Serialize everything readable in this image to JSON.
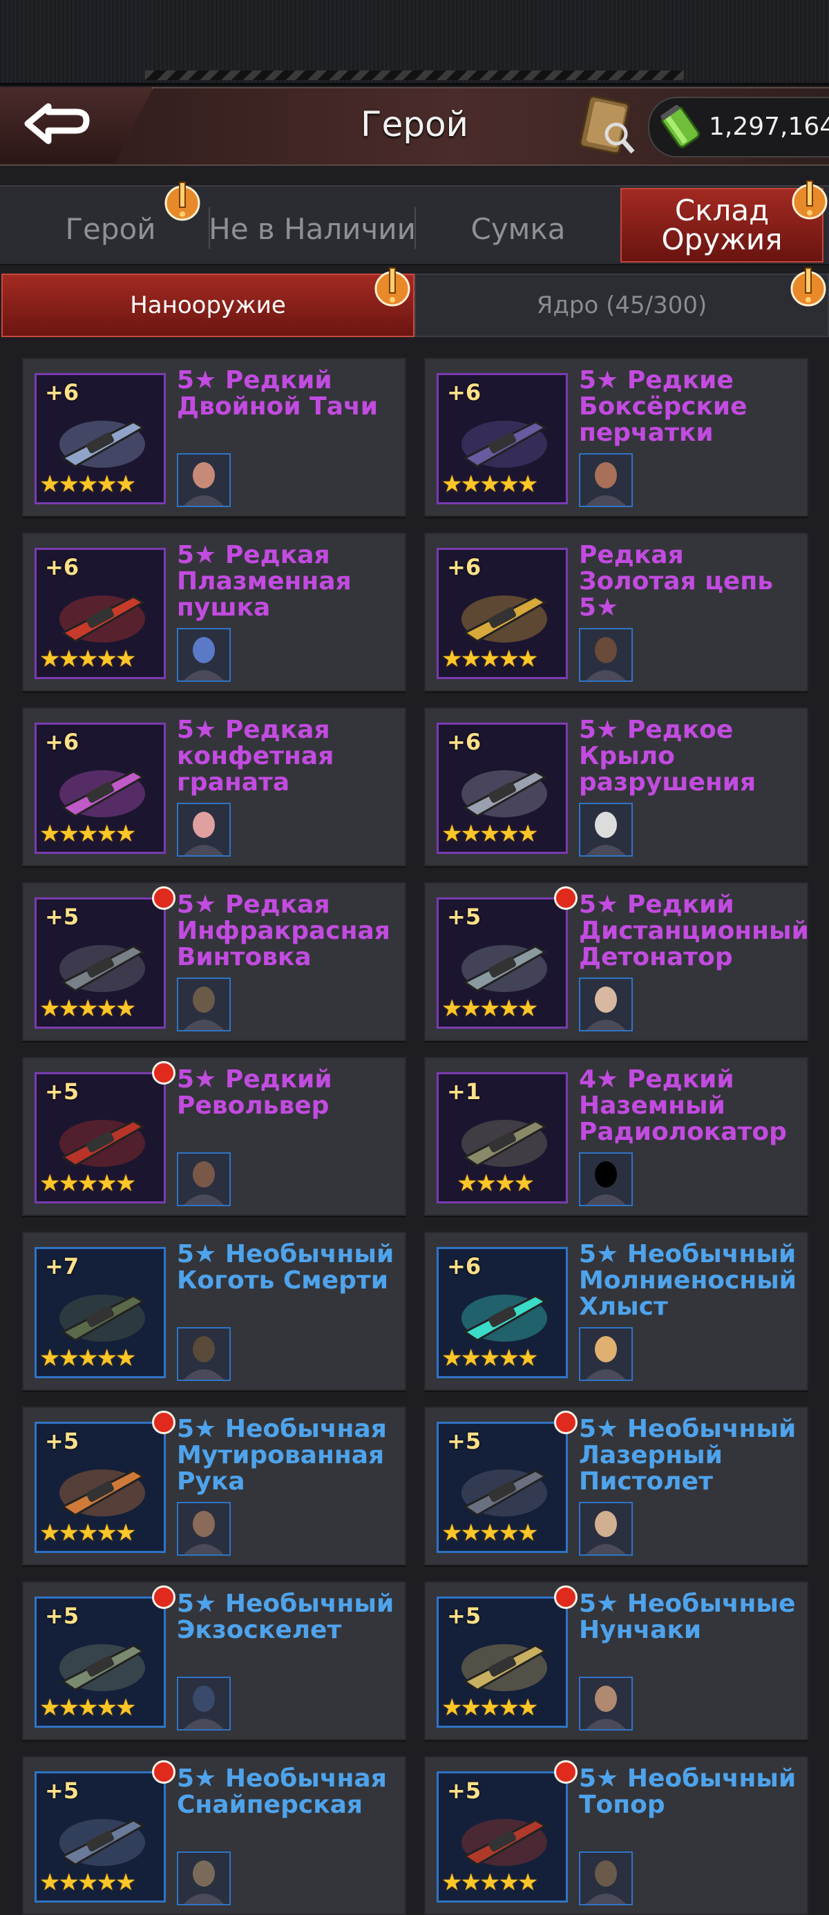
{
  "header": {
    "title": "Герой",
    "currency_amount": "1,297,164"
  },
  "tabs": [
    {
      "label": "Герой",
      "active": false,
      "alert": true
    },
    {
      "label": "Не в Наличии",
      "active": false,
      "alert": false
    },
    {
      "label": "Сумка",
      "active": false,
      "alert": false
    },
    {
      "label": "Склад Оружия",
      "active": true,
      "alert": true
    }
  ],
  "subtabs": [
    {
      "label": "Нанооружие",
      "active": true,
      "alert": true
    },
    {
      "label": "Ядро (45/300)",
      "active": false,
      "alert": true
    }
  ],
  "items": [
    {
      "name": "5★ Редкий Двойной Тачи",
      "level": "+6",
      "stars": 5,
      "rarity": "rare",
      "new": false
    },
    {
      "name": "5★ Редкие Боксёрские перчатки",
      "level": "+6",
      "stars": 5,
      "rarity": "rare",
      "new": false
    },
    {
      "name": "5★ Редкая Плазменная пушка",
      "level": "+6",
      "stars": 5,
      "rarity": "rare",
      "new": false
    },
    {
      "name": "Редкая Золотая цепь 5★",
      "level": "+6",
      "stars": 5,
      "rarity": "rare",
      "new": false
    },
    {
      "name": "5★ Редкая конфетная граната",
      "level": "+6",
      "stars": 5,
      "rarity": "rare",
      "new": false
    },
    {
      "name": "5★ Редкое Крыло разрушения",
      "level": "+6",
      "stars": 5,
      "rarity": "rare",
      "new": false
    },
    {
      "name": "5★ Редкая Инфракрасная Винтовка",
      "level": "+5",
      "stars": 5,
      "rarity": "rare",
      "new": true
    },
    {
      "name": "5★ Редкий Дистанционный Детонатор",
      "level": "+5",
      "stars": 5,
      "rarity": "rare",
      "new": true
    },
    {
      "name": "5★ Редкий Револьвер",
      "level": "+5",
      "stars": 5,
      "rarity": "rare",
      "new": true
    },
    {
      "name": "4★ Редкий Наземный Радиолокатор",
      "level": "+1",
      "stars": 4,
      "rarity": "rare",
      "new": false
    },
    {
      "name": "5★ Необычный Коготь Смерти",
      "level": "+7",
      "stars": 5,
      "rarity": "uncommon",
      "new": false
    },
    {
      "name": "5★ Необычный Молниеносный Хлыст",
      "level": "+6",
      "stars": 5,
      "rarity": "uncommon",
      "new": false
    },
    {
      "name": "5★ Необычная Мутированная Рука",
      "level": "+5",
      "stars": 5,
      "rarity": "uncommon",
      "new": true
    },
    {
      "name": "5★ Необычный Лазерный Пистолет",
      "level": "+5",
      "stars": 5,
      "rarity": "uncommon",
      "new": true
    },
    {
      "name": "5★ Необычный Экзоскелет",
      "level": "+5",
      "stars": 5,
      "rarity": "uncommon",
      "new": true
    },
    {
      "name": "5★ Необычные Нунчаки",
      "level": "+5",
      "stars": 5,
      "rarity": "uncommon",
      "new": true
    },
    {
      "name": "5★ Необычная Снайперская",
      "level": "+5",
      "stars": 5,
      "rarity": "uncommon",
      "new": true
    },
    {
      "name": "5★ Необычный Топор",
      "level": "+5",
      "stars": 5,
      "rarity": "uncommon",
      "new": true
    }
  ],
  "colors": {
    "rare_text": "#c24be0",
    "uncommon_text": "#4ea3ec",
    "active_tab": "#a22a22",
    "star": "#ffc629",
    "new_dot": "#e02a1e"
  }
}
